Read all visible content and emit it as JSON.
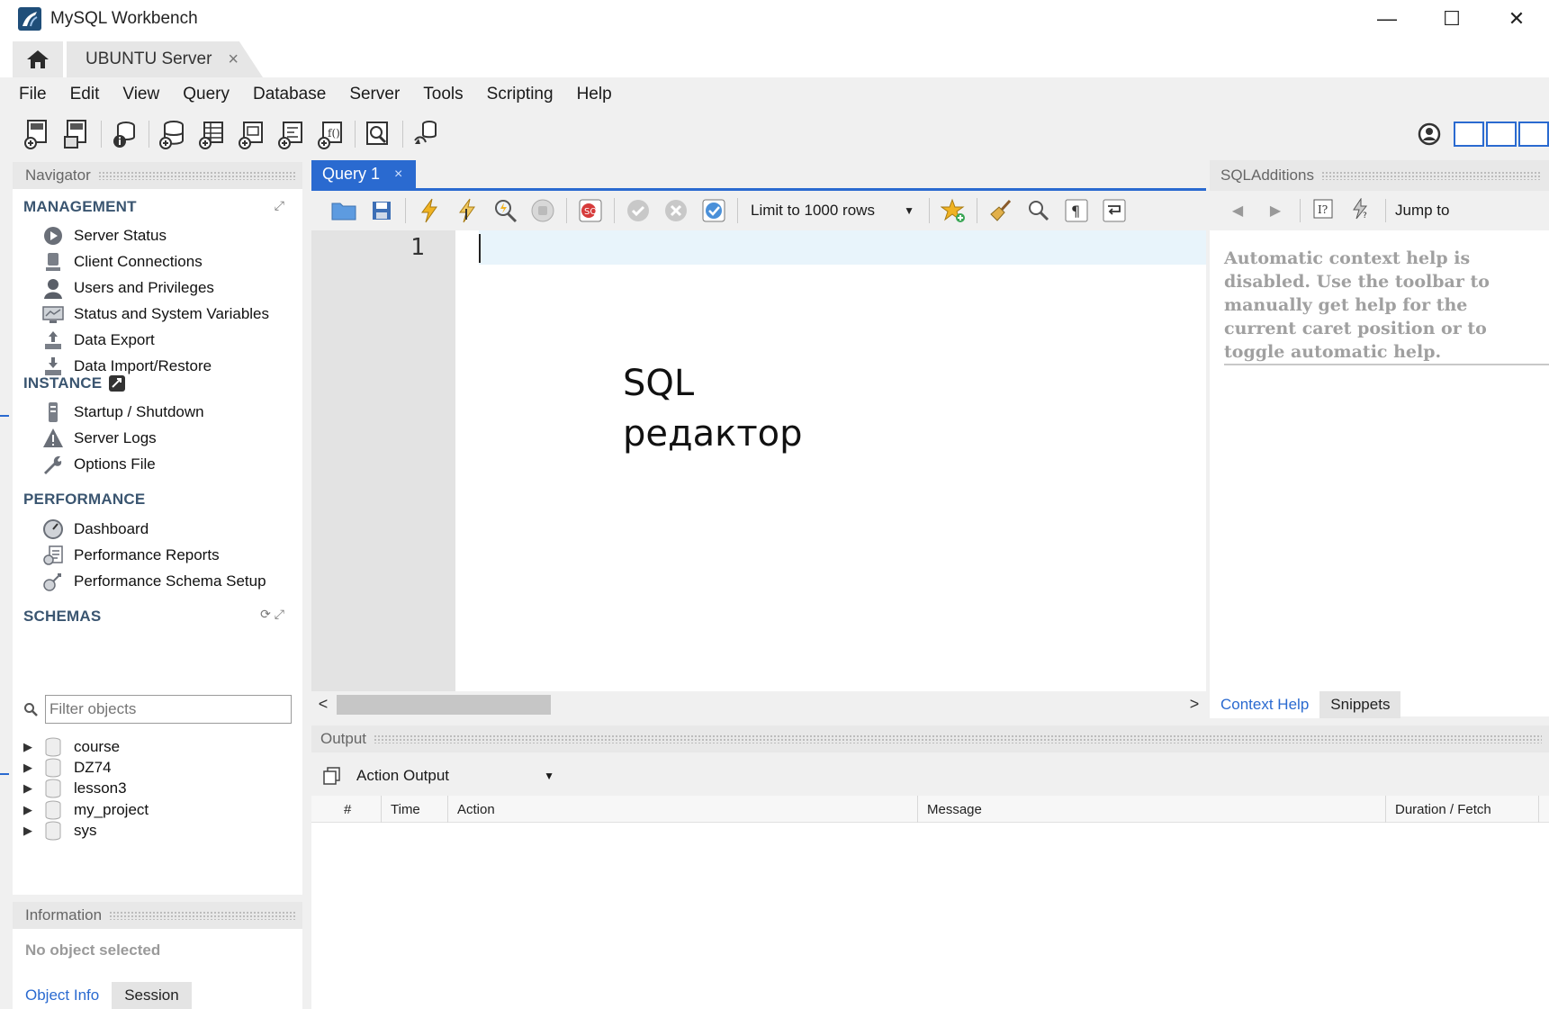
{
  "window": {
    "title": "MySQL Workbench",
    "minimize": "—",
    "maximize": "☐",
    "close": "✕"
  },
  "tabs": {
    "connection_tab": "UBUNTU Server",
    "close_glyph": "×"
  },
  "menu": [
    "File",
    "Edit",
    "View",
    "Query",
    "Database",
    "Server",
    "Tools",
    "Scripting",
    "Help"
  ],
  "navigator": {
    "header": "Navigator",
    "management": {
      "title": "MANAGEMENT",
      "items": [
        "Server Status",
        "Client Connections",
        "Users and Privileges",
        "Status and System Variables",
        "Data Export",
        "Data Import/Restore"
      ]
    },
    "instance": {
      "title": "INSTANCE",
      "items": [
        "Startup / Shutdown",
        "Server Logs",
        "Options File"
      ]
    },
    "performance": {
      "title": "PERFORMANCE",
      "items": [
        "Dashboard",
        "Performance Reports",
        "Performance Schema Setup"
      ]
    },
    "schemas": {
      "title": "SCHEMAS",
      "filter_placeholder": "Filter objects",
      "items": [
        "course",
        "DZ74",
        "lesson3",
        "my_project",
        "sys"
      ]
    }
  },
  "information": {
    "header": "Information",
    "empty_text": "No object selected",
    "tabs": [
      "Object Info",
      "Session"
    ]
  },
  "query": {
    "tab_label": "Query 1",
    "close_glyph": "×",
    "limit_label": "Limit to 1000 rows",
    "line_number": "1",
    "annotation_line1": "SQL",
    "annotation_line2": "редактор"
  },
  "output": {
    "header": "Output",
    "selector": "Action Output",
    "columns": [
      "#",
      "Time",
      "Action",
      "Message",
      "Duration / Fetch"
    ]
  },
  "sql_additions": {
    "header": "SQLAdditions",
    "jump_to": "Jump to",
    "help_text": "Automatic context help is disabled. Use the toolbar to manually get help for the current caret position or to toggle automatic help.",
    "tabs": [
      "Context Help",
      "Snippets"
    ]
  },
  "colors": {
    "accent": "#2a6ad0",
    "section_title": "#3a5570"
  },
  "icons": {
    "home": "home-icon",
    "new-sql-tab": "sql-file-icon",
    "open-sql": "open-sql-icon",
    "inspector": "info-icon",
    "create-schema": "database-add-icon",
    "create-table": "table-add-icon",
    "create-view": "view-add-icon",
    "create-procedure": "procedure-add-icon",
    "create-function": "function-add-icon",
    "search-table-data": "search-data-icon",
    "reconnect": "reconnect-icon",
    "preferences": "gear-icon"
  }
}
